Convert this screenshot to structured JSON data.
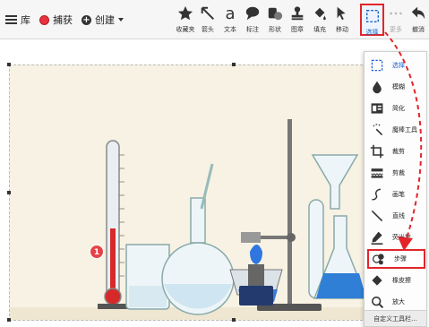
{
  "toolbar": {
    "menu_label": "库",
    "capture_label": "捕获",
    "create_label": "创建",
    "tools": [
      {
        "id": "favorites",
        "label": "收藏夹",
        "icon": "star-icon"
      },
      {
        "id": "arrow",
        "label": "箭头",
        "icon": "arrow-icon"
      },
      {
        "id": "text",
        "label": "文本",
        "icon": "text-a-icon"
      },
      {
        "id": "callout",
        "label": "标注",
        "icon": "callout-icon"
      },
      {
        "id": "shape",
        "label": "形状",
        "icon": "shape-icon"
      },
      {
        "id": "stamp",
        "label": "图章",
        "icon": "stamp-icon"
      },
      {
        "id": "fill",
        "label": "填充",
        "icon": "fill-icon"
      },
      {
        "id": "move",
        "label": "移动",
        "icon": "move-icon"
      },
      {
        "id": "select",
        "label": "选择",
        "icon": "selection-icon",
        "selected": true
      },
      {
        "id": "more",
        "label": "更多",
        "icon": "more-icon"
      },
      {
        "id": "undo",
        "label": "撤消",
        "icon": "undo-icon"
      }
    ]
  },
  "dropdown": {
    "items": [
      {
        "label": "选择",
        "icon": "selection-icon",
        "selected": true
      },
      {
        "label": "模糊",
        "icon": "blur-drop-icon"
      },
      {
        "label": "简化",
        "icon": "simplify-icon"
      },
      {
        "label": "魔棒工具",
        "icon": "magic-wand-icon"
      },
      {
        "label": "裁剪",
        "icon": "crop-icon"
      },
      {
        "label": "剪裁",
        "icon": "cut-out-icon"
      },
      {
        "label": "画笔",
        "icon": "pen-icon"
      },
      {
        "label": "直线",
        "icon": "line-icon"
      },
      {
        "label": "荧光笔",
        "icon": "highlighter-icon"
      },
      {
        "label": "步骤",
        "icon": "step-icon",
        "highlighted": true
      },
      {
        "label": "橡皮擦",
        "icon": "eraser-icon"
      },
      {
        "label": "放大",
        "icon": "magnify-icon"
      }
    ],
    "footer_label": "自定义工具栏..."
  },
  "canvas": {
    "step_badge_number": "1"
  },
  "colors": {
    "highlight_red": "#e2252b",
    "accent_blue": "#1e5fcf",
    "paper": "#f7f2e3"
  }
}
